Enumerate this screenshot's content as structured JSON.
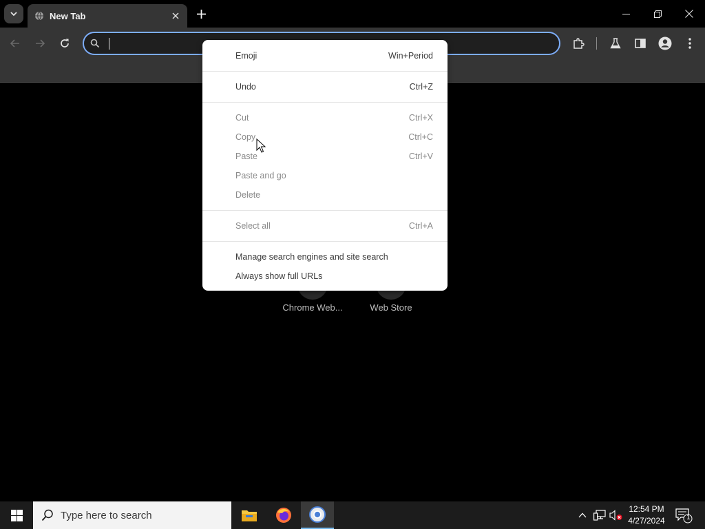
{
  "tabstrip": {
    "tab_title": "New Tab"
  },
  "toolbar": {
    "omnibox_value": ""
  },
  "context_menu": {
    "groups": [
      [
        {
          "label": "Emoji",
          "shortcut": "Win+Period",
          "enabled": true
        }
      ],
      [
        {
          "label": "Undo",
          "shortcut": "Ctrl+Z",
          "enabled": true
        }
      ],
      [
        {
          "label": "Cut",
          "shortcut": "Ctrl+X",
          "enabled": false
        },
        {
          "label": "Copy",
          "shortcut": "Ctrl+C",
          "enabled": false
        },
        {
          "label": "Paste",
          "shortcut": "Ctrl+V",
          "enabled": false
        },
        {
          "label": "Paste and go",
          "shortcut": "",
          "enabled": false
        },
        {
          "label": "Delete",
          "shortcut": "",
          "enabled": false
        }
      ],
      [
        {
          "label": "Select all",
          "shortcut": "Ctrl+A",
          "enabled": false
        }
      ],
      [
        {
          "label": "Manage search engines and site search",
          "shortcut": "",
          "enabled": true
        },
        {
          "label": "Always show full URLs",
          "shortcut": "",
          "enabled": true
        }
      ]
    ]
  },
  "shortcuts": [
    {
      "label": "Chrome Web..."
    },
    {
      "label": "Web Store"
    }
  ],
  "taskbar": {
    "search_placeholder": "Type here to search",
    "time": "12:54 PM",
    "date": "4/27/2024",
    "notification_count": "1"
  },
  "icons": {
    "tab_search": "chevron-down-icon",
    "favicon": "globe-icon",
    "close": "close-icon",
    "new_tab": "plus-icon",
    "back": "arrow-left-icon",
    "forward": "arrow-right-icon",
    "reload": "reload-icon",
    "omnibox": "search-icon",
    "extensions": "puzzle-icon",
    "labs": "flask-icon",
    "side_panel": "side-panel-icon",
    "profile": "account-icon",
    "menu": "more-vert-icon"
  },
  "colors": {
    "accent": "#7cacf8",
    "toolbar": "#353535",
    "menu_bg": "#ffffff",
    "disabled_text": "#8a8a8a"
  }
}
